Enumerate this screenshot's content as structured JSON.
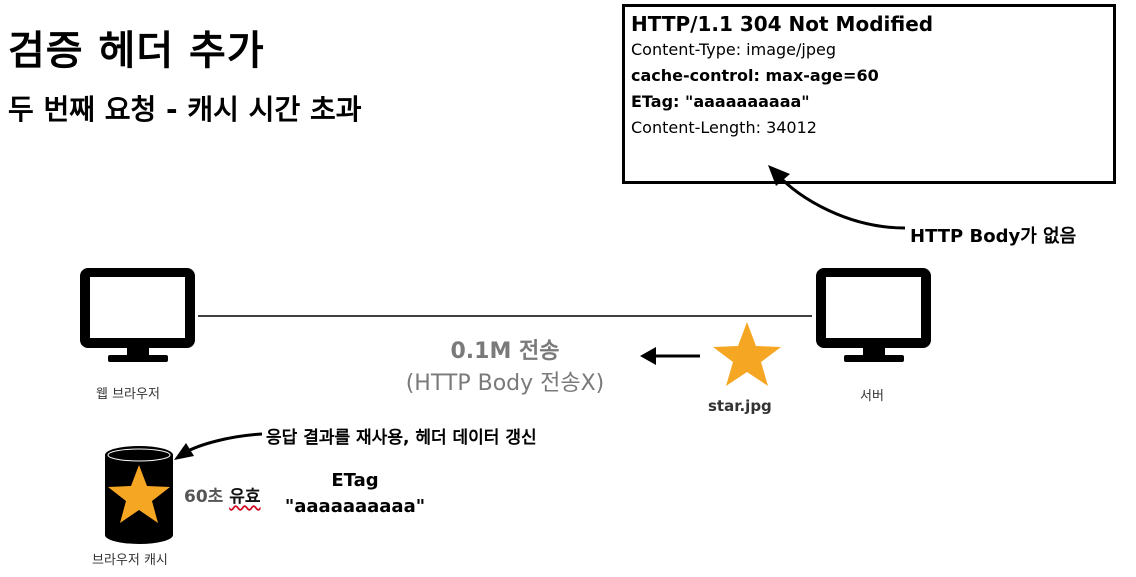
{
  "title": "검증 헤더 추가",
  "subtitle": "두 번째 요청 - 캐시 시간 초과",
  "response": {
    "status": "HTTP/1.1 304 Not Modified",
    "headers": [
      "Content-Type: image/jpeg",
      "cache-control: max-age=60",
      "ETag: \"aaaaaaaaaa\"",
      "Content-Length: 34012"
    ]
  },
  "no_body_note": "HTTP Body가 없음",
  "transfer": {
    "size": "0.1M 전송",
    "note": "(HTTP Body 전송X)"
  },
  "browser": {
    "label": "웹 브라우저"
  },
  "server": {
    "label": "서버",
    "file": "star.jpg"
  },
  "cache": {
    "label": "브라우저 캐시",
    "reuse_note": "응답 결과를 재사용, 헤더 데이터 갱신",
    "validity_prefix": "60초",
    "validity_suffix": "유효",
    "etag_label": "ETag",
    "etag_value": "\"aaaaaaaaaa\""
  },
  "colors": {
    "star": "#f5a623",
    "transfer_text": "#7a7a7a",
    "underline": "#d0021b"
  }
}
